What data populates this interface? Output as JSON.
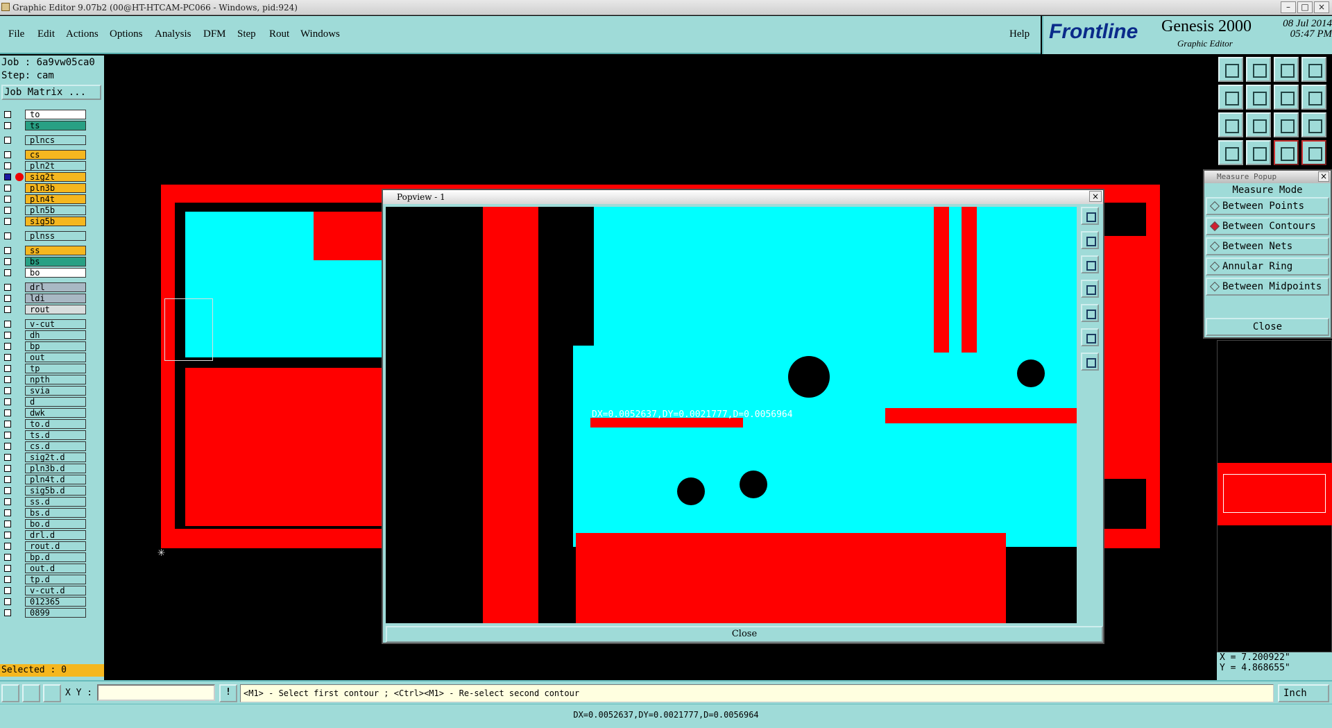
{
  "window": {
    "title": "Graphic Editor 9.07b2 (00@HT-HTCAM-PC066 - Windows, pid:924)"
  },
  "menu": {
    "items": [
      "File",
      "Edit",
      "Actions",
      "Options",
      "Analysis",
      "DFM",
      "Step",
      "Rout",
      "Windows"
    ],
    "help": "Help"
  },
  "brand": {
    "logo": "Frontline",
    "product": "Genesis 2000",
    "subtitle": "Graphic Editor",
    "date": "08 Jul 2014",
    "time": "05:47 PM"
  },
  "job": {
    "job_label": "Job : 6a9vw05ca0",
    "step_label": "Step: cam",
    "matrix_button": "Job Matrix ..."
  },
  "layers": [
    {
      "name": "to",
      "style": "w"
    },
    {
      "name": "ts",
      "style": "g"
    },
    {
      "name": "plncs",
      "style": ""
    },
    {
      "name": "cs",
      "style": "o"
    },
    {
      "name": "pln2t",
      "style": ""
    },
    {
      "name": "sig2t",
      "style": "o",
      "active": true
    },
    {
      "name": "pln3b",
      "style": "o"
    },
    {
      "name": "pln4t",
      "style": "o"
    },
    {
      "name": "pln5b",
      "style": ""
    },
    {
      "name": "sig5b",
      "style": "o"
    },
    {
      "name": "plnss",
      "style": ""
    },
    {
      "name": "ss",
      "style": "o"
    },
    {
      "name": "bs",
      "style": "g"
    },
    {
      "name": "bo",
      "style": "w"
    },
    {
      "name": "drl",
      "style": "gr"
    },
    {
      "name": "ldi",
      "style": "gr"
    },
    {
      "name": "rout",
      "style": "lg"
    },
    {
      "name": "v-cut",
      "style": ""
    },
    {
      "name": "dh",
      "style": ""
    },
    {
      "name": "bp",
      "style": ""
    },
    {
      "name": "out",
      "style": ""
    },
    {
      "name": "tp",
      "style": ""
    },
    {
      "name": "npth",
      "style": ""
    },
    {
      "name": "svia",
      "style": ""
    },
    {
      "name": "d",
      "style": ""
    },
    {
      "name": "dwk",
      "style": ""
    },
    {
      "name": "to.d",
      "style": ""
    },
    {
      "name": "ts.d",
      "style": ""
    },
    {
      "name": "cs.d",
      "style": ""
    },
    {
      "name": "sig2t.d",
      "style": ""
    },
    {
      "name": "pln3b.d",
      "style": ""
    },
    {
      "name": "pln4t.d",
      "style": ""
    },
    {
      "name": "sig5b.d",
      "style": ""
    },
    {
      "name": "ss.d",
      "style": ""
    },
    {
      "name": "bs.d",
      "style": ""
    },
    {
      "name": "bo.d",
      "style": ""
    },
    {
      "name": "drl.d",
      "style": ""
    },
    {
      "name": "rout.d",
      "style": ""
    },
    {
      "name": "bp.d",
      "style": ""
    },
    {
      "name": "out.d",
      "style": ""
    },
    {
      "name": "tp.d",
      "style": ""
    },
    {
      "name": "v-cut.d",
      "style": ""
    },
    {
      "name": "012365",
      "style": ""
    },
    {
      "name": "0899",
      "style": ""
    }
  ],
  "selected": "Selected : 0",
  "popview": {
    "title": "Popview - 1",
    "close": "Close",
    "measure_text": "DX=0.0052637,DY=0.0021777,D=0.0056964"
  },
  "measure_popup": {
    "title": "Measure Popup",
    "mode_label": "Measure Mode",
    "options": [
      "Between Points",
      "Between Contours",
      "Between Nets",
      "Annular Ring",
      "Between Midpoints"
    ],
    "selected": "Between Contours",
    "close": "Close"
  },
  "coords": {
    "x": "X = 7.200922\"",
    "y": "Y = 4.868655\""
  },
  "cmdbar": {
    "xy_label": "X Y :",
    "xy_value": "",
    "prompt": "<M1> - Select first contour ; <Ctrl><M1> - Re-select second contour",
    "units": "Inch"
  },
  "status": {
    "text": "DX=0.0052637,DY=0.0021777,D=0.0056964"
  },
  "colors": {
    "panel": "#9fdbd8",
    "copper": "#ff0000",
    "surface": "#00ffff"
  }
}
